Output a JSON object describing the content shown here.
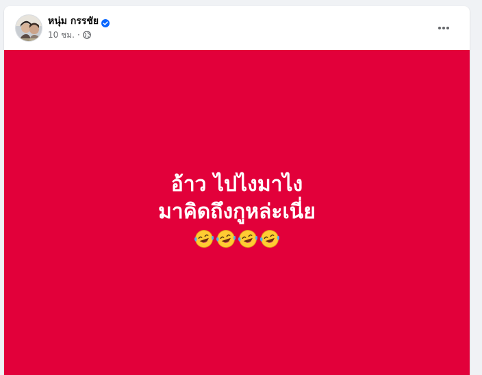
{
  "post": {
    "author": "หนุ่ม กรรชัย",
    "verified_icon": "verified-badge-icon",
    "time": "10 ชม.",
    "separator": "·",
    "audience_icon": "globe-icon",
    "more_icon": "more-options-icon",
    "image": {
      "background_color": "#e2003a",
      "lines": [
        "อ้าว ไปไงมาไง",
        "มาคิดถึงกูหล่ะเนี่ย"
      ],
      "emoji_icons": [
        "laughing-tears-icon",
        "laughing-tears-icon",
        "laughing-tears-icon",
        "laughing-tears-icon"
      ]
    }
  },
  "colors": {
    "page_background": "#f0f2f5",
    "card_background": "#ffffff",
    "name_text": "#050505",
    "secondary_text": "#65676b",
    "verified_blue": "#0866ff"
  }
}
